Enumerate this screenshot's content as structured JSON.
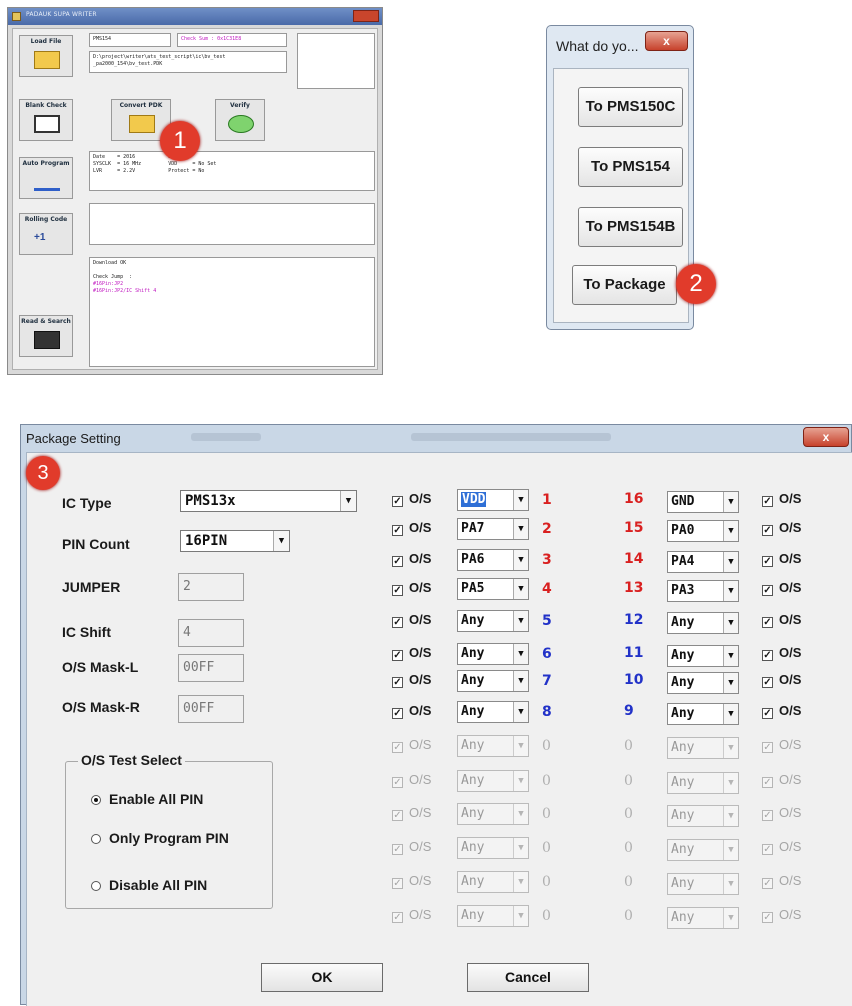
{
  "writer": {
    "title": "PADAUK SUPA WRITER",
    "buttons": {
      "load_file": "Load File",
      "blank_check": "Blank Check",
      "auto_program": "Auto Program",
      "rolling_code": "Rolling Code",
      "read_search": "Read & Search",
      "convert_pdk": "Convert PDK",
      "verify": "Verify"
    },
    "rolling_plus": "+1",
    "ic_name": "PMS154",
    "checksum": "Check Sum : 0x1C31E8",
    "path_line1": "D:\\project\\writer\\ats_test_script\\ic\\bv_test",
    "path_line2": "_pa2000_154\\bv_test.PDK",
    "info_line1": "Date    = 2016           21:25",
    "info_line2": "SYSCLK  = 16 MHz         VDD     = No Set",
    "info_line3": "LVR     = 2.2V           Protect = No",
    "log_line1": "Download OK",
    "log_line2": "Check Jump  :",
    "log_line3": "#16Pin:JP2",
    "log_line4": "#16Pin:JP2/IC Shift 4"
  },
  "badges": {
    "one": "1",
    "two": "2",
    "three": "3"
  },
  "dialog": {
    "title": "What do yo...",
    "close_glyph": "x",
    "buttons": [
      "To PMS150C",
      "To PMS154",
      "To PMS154B",
      "To Package"
    ]
  },
  "package": {
    "title": "Package Setting",
    "close_glyph": "x",
    "labels": {
      "ic_type": "IC Type",
      "pin_count": "PIN Count",
      "jumper": "JUMPER",
      "ic_shift": "IC Shift",
      "mask_l": "O/S Mask-L",
      "mask_r": "O/S Mask-R"
    },
    "values": {
      "ic_type": "PMS13x",
      "pin_count": "16PIN",
      "jumper": "2",
      "ic_shift": "4",
      "mask_l": "00FF",
      "mask_r": "00FF"
    },
    "os_group": {
      "legend": "O/S Test Select",
      "options": [
        "Enable All PIN",
        "Only Program PIN",
        "Disable All PIN"
      ],
      "selected": "Enable All PIN"
    },
    "os_label": "O/S",
    "check_glyph": "✓",
    "arrow_glyph": "▼",
    "left_pins": [
      {
        "pin": "VDD",
        "num": "1"
      },
      {
        "pin": "PA7",
        "num": "2"
      },
      {
        "pin": "PA6",
        "num": "3"
      },
      {
        "pin": "PA5",
        "num": "4"
      },
      {
        "pin": "Any",
        "num": "5"
      },
      {
        "pin": "Any",
        "num": "6"
      },
      {
        "pin": "Any",
        "num": "7"
      },
      {
        "pin": "Any",
        "num": "8"
      },
      {
        "pin": "Any",
        "num": "0"
      },
      {
        "pin": "Any",
        "num": "0"
      },
      {
        "pin": "Any",
        "num": "0"
      },
      {
        "pin": "Any",
        "num": "0"
      },
      {
        "pin": "Any",
        "num": "0"
      },
      {
        "pin": "Any",
        "num": "0"
      }
    ],
    "right_pins": [
      {
        "pin": "GND",
        "num": "16"
      },
      {
        "pin": "PA0",
        "num": "15"
      },
      {
        "pin": "PA4",
        "num": "14"
      },
      {
        "pin": "PA3",
        "num": "13"
      },
      {
        "pin": "Any",
        "num": "12"
      },
      {
        "pin": "Any",
        "num": "11"
      },
      {
        "pin": "Any",
        "num": "10"
      },
      {
        "pin": "Any",
        "num": "9"
      },
      {
        "pin": "Any",
        "num": "0"
      },
      {
        "pin": "Any",
        "num": "0"
      },
      {
        "pin": "Any",
        "num": "0"
      },
      {
        "pin": "Any",
        "num": "0"
      },
      {
        "pin": "Any",
        "num": "0"
      },
      {
        "pin": "Any",
        "num": "0"
      }
    ],
    "ok_label": "OK",
    "cancel_label": "Cancel"
  }
}
